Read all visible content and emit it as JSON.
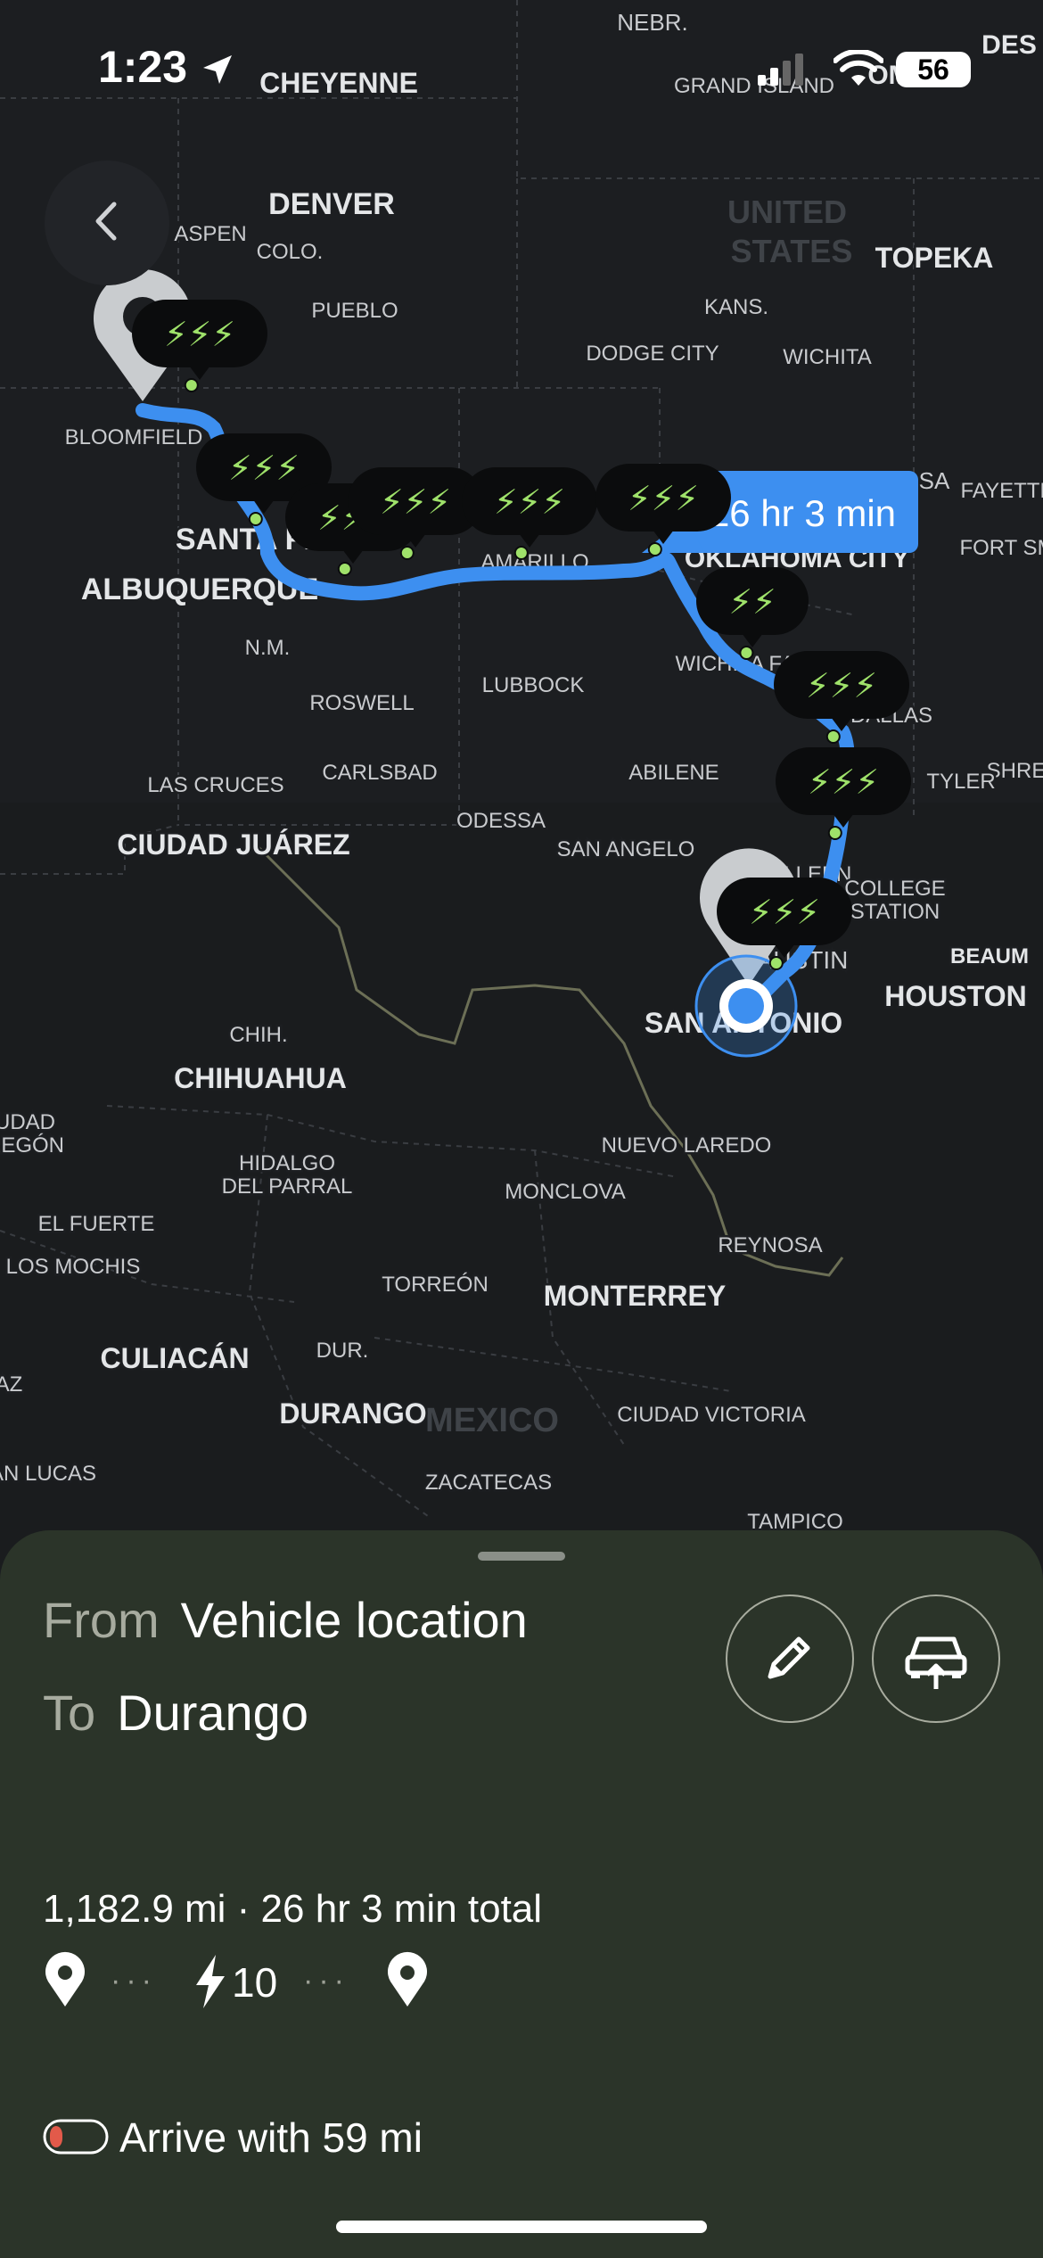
{
  "status_bar": {
    "time": "1:23",
    "battery": "56"
  },
  "map": {
    "region_labels": {
      "united_states": "UNITED\nSTATES",
      "mexico": "MEXICO"
    },
    "labels": [
      {
        "text": "NEBR."
      },
      {
        "text": "CHEYENNE"
      },
      {
        "text": "GRAND ISLAND"
      },
      {
        "text": "OMAHA"
      },
      {
        "text": "DES"
      },
      {
        "text": "DENVER"
      },
      {
        "text": "ASPEN"
      },
      {
        "text": "COLO."
      },
      {
        "text": "TOPEKA"
      },
      {
        "text": "PUEBLO"
      },
      {
        "text": "KANS."
      },
      {
        "text": "DODGE CITY"
      },
      {
        "text": "WICHITA"
      },
      {
        "text": "BLOOMFIELD"
      },
      {
        "text": "SA"
      },
      {
        "text": "FAYETTE"
      },
      {
        "text": "SANTA FE"
      },
      {
        "text": "ALBUQUERQUE"
      },
      {
        "text": "AMARILLO"
      },
      {
        "text": "OKLAHOMA CITY"
      },
      {
        "text": "FORT SM"
      },
      {
        "text": "N.M."
      },
      {
        "text": "LUBBOCK"
      },
      {
        "text": "WICHITA FALLS"
      },
      {
        "text": "ROSWELL"
      },
      {
        "text": "DALLAS"
      },
      {
        "text": "SHRE"
      },
      {
        "text": "LAS CRUCES"
      },
      {
        "text": "CARLSBAD"
      },
      {
        "text": "ABILENE"
      },
      {
        "text": "TYLER"
      },
      {
        "text": "ODESSA"
      },
      {
        "text": "CIUDAD JUÁREZ"
      },
      {
        "text": "SAN ANGELO"
      },
      {
        "text": "KILLEEN"
      },
      {
        "text": "COLLEGE\nSTATION"
      },
      {
        "text": "AUSTIN"
      },
      {
        "text": "BEAUM"
      },
      {
        "text": "HOUSTON"
      },
      {
        "text": "SAN ANTONIO"
      },
      {
        "text": "CHIH."
      },
      {
        "text": "CHIHUAHUA"
      },
      {
        "text": "NUEVO LAREDO"
      },
      {
        "text": "UDAD\nREGÓN"
      },
      {
        "text": "HIDALGO\nDEL PARRAL"
      },
      {
        "text": "MONCLOVA"
      },
      {
        "text": "EL FUERTE"
      },
      {
        "text": "REYNOSA"
      },
      {
        "text": "LOS MOCHIS"
      },
      {
        "text": "TORREÓN"
      },
      {
        "text": "MONTERREY"
      },
      {
        "text": "CULIACÁN"
      },
      {
        "text": "DUR."
      },
      {
        "text": "AZ"
      },
      {
        "text": "DURANGO"
      },
      {
        "text": "CIUDAD VICTORIA"
      },
      {
        "text": "AN LUCAS"
      },
      {
        "text": "ZACATECAS"
      },
      {
        "text": "TAMPICO"
      }
    ],
    "eta_bubble": "26 hr 3 min",
    "charger_glyph": "⚡⚡⚡",
    "charger_glyph_2": "⚡⚡",
    "route_color": "#3d8ff0",
    "charger_bolt_color": "#9fe26a"
  },
  "sheet": {
    "from_label": "From",
    "from_value": "Vehicle location",
    "to_label": "To",
    "to_value": "Durango",
    "summary": "1,182.9 mi · 26 hr 3 min total",
    "charge_stops": "10",
    "arrive": "Arrive with 59 mi"
  }
}
